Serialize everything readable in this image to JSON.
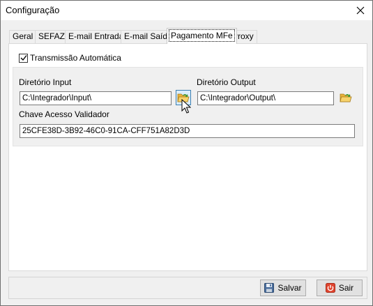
{
  "window": {
    "title": "Configuração",
    "close_icon": "close-icon"
  },
  "tabs": [
    {
      "label": "Geral",
      "active": false
    },
    {
      "label": "SEFAZ",
      "active": false
    },
    {
      "label": "E-mail Entrada",
      "active": false
    },
    {
      "label": "E-mail Saída",
      "active": false
    },
    {
      "label": "Pagamento MFe",
      "active": true
    },
    {
      "label": "Proxy",
      "active": false
    }
  ],
  "panel": {
    "auto_transmission": {
      "label": "Transmissão Automática",
      "checked": true
    },
    "input_dir": {
      "label": "Diretório Input",
      "value": "C:\\Integrador\\Input\\",
      "button_icon": "folder-open-icon"
    },
    "output_dir": {
      "label": "Diretório Output",
      "value": "C:\\Integrador\\Output\\",
      "button_icon": "folder-open-icon"
    },
    "validator_key": {
      "label": "Chave Acesso Validador",
      "value": "25CFE38D-3B92-46C0-91CA-CFF751A82D3D"
    }
  },
  "footer": {
    "save_label": "Salvar",
    "exit_label": "Sair",
    "save_icon": "floppy-disk-icon",
    "exit_icon": "power-icon"
  },
  "colors": {
    "window_bg": "#f0f0f0",
    "panel_bg": "#ffffff",
    "folder_yellow": "#f2c14e",
    "folder_arrow": "#3a9a3a",
    "exit_red": "#e0442e"
  }
}
